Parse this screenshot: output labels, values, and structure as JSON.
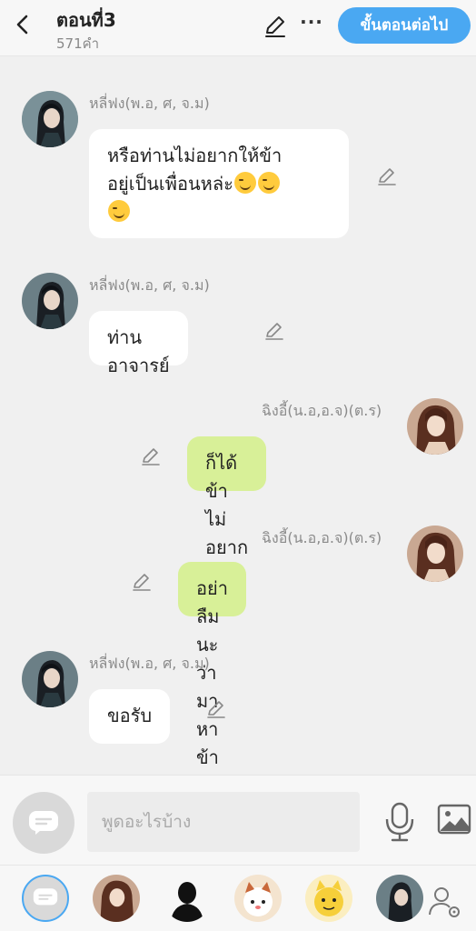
{
  "header": {
    "title": "ตอนที่3",
    "word_count": "571คำ",
    "next_button": "ขั้นตอนต่อไป",
    "more_label": "···",
    "accent_color": "#4aa8f2"
  },
  "messages": [
    {
      "side": "left",
      "sender": "หลี่ฟง(พ.อ, ศ, จ.ม)",
      "text_lines": [
        "หรือท่านไม่อยากให้ข้า",
        "อยู่เป็นเพื่อนหล่ะ"
      ],
      "emoji": "smirking-face",
      "emoji_count": 3
    },
    {
      "side": "left",
      "sender": "หลี่ฟง(พ.อ, ศ, จ.ม)",
      "text": "ท่านอาจารย์"
    },
    {
      "side": "right",
      "sender": "ฉิงอี้(น.อ,อ.จ)(ต.ร)",
      "text": "ก็ได้ข้าไม่อยากรู้ล่ะ"
    },
    {
      "side": "right",
      "sender": "ฉิงอี้(น.อ,อ.จ)(ต.ร)",
      "text": "อย่าลืมนะว่ามาหาข้า"
    },
    {
      "side": "left",
      "sender": "หลี่ฟง(พ.อ, ศ, จ.ม)",
      "text": "ขอรับ"
    }
  ],
  "composer": {
    "placeholder": "พูดอะไรบ้าง"
  },
  "colors": {
    "left_bubble": "#ffffff",
    "right_bubble": "#d8f098",
    "background": "#f0f0f0"
  }
}
